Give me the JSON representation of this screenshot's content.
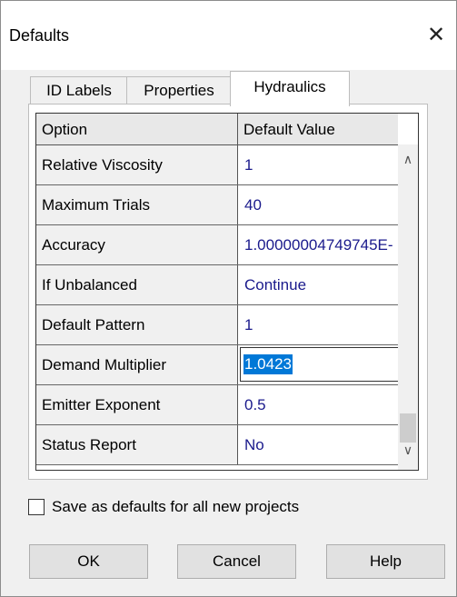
{
  "window": {
    "title": "Defaults"
  },
  "icons": {
    "close": "close-icon",
    "scroll_up": "chevron-up-icon",
    "scroll_down": "chevron-down-icon"
  },
  "tabs": [
    {
      "label": "ID Labels",
      "active": false
    },
    {
      "label": "Properties",
      "active": false
    },
    {
      "label": "Hydraulics",
      "active": true
    }
  ],
  "grid": {
    "columns": [
      "Option",
      "Default Value"
    ],
    "rows": [
      {
        "option": "Relative Viscosity",
        "value": "1"
      },
      {
        "option": "Maximum Trials",
        "value": "40"
      },
      {
        "option": "Accuracy",
        "value": "1.00000004749745E-"
      },
      {
        "option": "If Unbalanced",
        "value": "Continue"
      },
      {
        "option": "Default Pattern",
        "value": "1"
      },
      {
        "option": "Demand Multiplier",
        "value": "1.0423",
        "editing": true
      },
      {
        "option": "Emitter Exponent",
        "value": "0.5"
      },
      {
        "option": "Status Report",
        "value": "No"
      }
    ]
  },
  "checkbox": {
    "label": "Save as defaults for all new projects",
    "checked": false
  },
  "buttons": {
    "ok": "OK",
    "cancel": "Cancel",
    "help": "Help"
  },
  "colors": {
    "value_text": "#1a1a8c",
    "selection": "#0078d7"
  }
}
